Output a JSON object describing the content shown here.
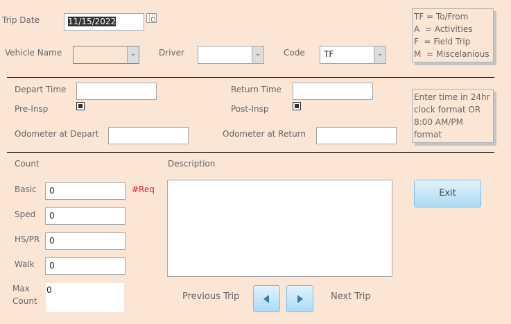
{
  "trip_date": {
    "label": "Trip Date",
    "value": "11/15/2022"
  },
  "vehicle": {
    "label": "Vehicle Name",
    "value": ""
  },
  "driver": {
    "label": "Driver",
    "value": ""
  },
  "code": {
    "label": "Code",
    "value": "TF"
  },
  "legend": [
    "TF = To/From",
    "A  = Activities",
    "F  = Field Trip",
    "M  = Miscelanious"
  ],
  "depart_time": {
    "label": "Depart Time",
    "value": ""
  },
  "return_time": {
    "label": "Return Time",
    "value": ""
  },
  "pre_insp": {
    "label": "Pre-Insp"
  },
  "post_insp": {
    "label": "Post-Insp"
  },
  "odo_depart": {
    "label": "Odometer at Depart",
    "value": ""
  },
  "odo_return": {
    "label": "Odometer at Return",
    "value": ""
  },
  "hint": [
    "Enter time in 24hr",
    "clock format OR",
    "8:00 AM/PM",
    "format"
  ],
  "count_label": "Count",
  "description_label": "Description",
  "counts": {
    "basic": {
      "label": "Basic",
      "value": "0"
    },
    "sped": {
      "label": "Sped",
      "value": "0"
    },
    "hspr": {
      "label": "HS/PR",
      "value": "0"
    },
    "walk": {
      "label": "Walk",
      "value": "0"
    },
    "max": {
      "label1": "Max",
      "label2": "Count",
      "value": "0"
    }
  },
  "req": "#Req",
  "exit_label": "Exit",
  "prev_label": "Previous Trip",
  "next_label": "Next Trip"
}
